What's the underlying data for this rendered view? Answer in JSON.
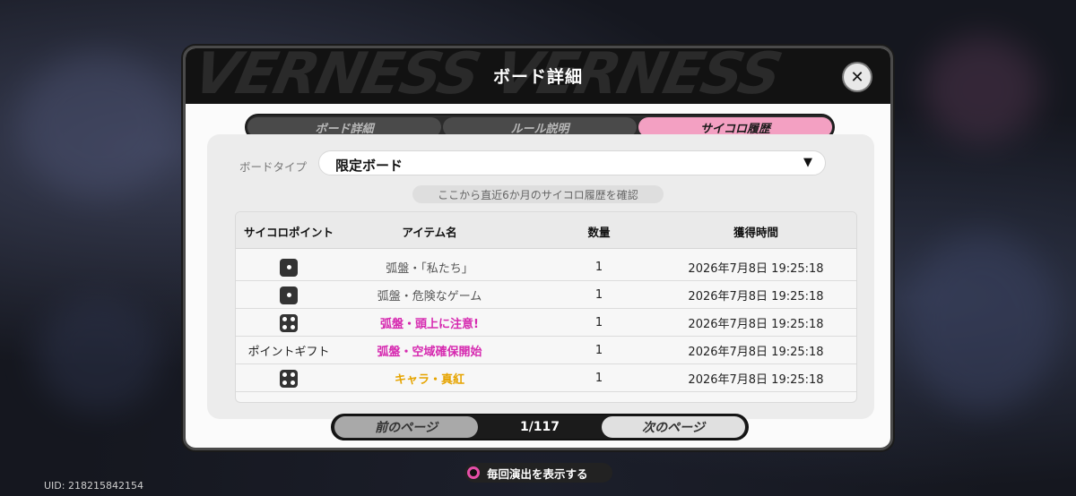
{
  "dialog": {
    "title": "ボード詳細",
    "close_icon": "close-icon",
    "header_deco": "VERNESS VERNESS"
  },
  "tabs": [
    {
      "label": "ボード詳細",
      "active": false
    },
    {
      "label": "ルール説明",
      "active": false
    },
    {
      "label": "サイコロ履歴",
      "active": true
    }
  ],
  "filter": {
    "label": "ボードタイプ",
    "selected": "限定ボード",
    "arrow_icon": "dropdown-arrow-icon"
  },
  "hint": "ここから直近6か月のサイコロ履歴を確認",
  "table": {
    "headers": [
      "サイコロポイント",
      "アイテム名",
      "数量",
      "獲得時間"
    ],
    "rows": [
      {
        "point": "dice-1-icon",
        "point_text": "",
        "item": "弧盤・「私たち」",
        "item_color": "normal",
        "qty": "1",
        "time": "2026年7月8日 19:25:18"
      },
      {
        "point": "dice-1-icon",
        "point_text": "",
        "item": "弧盤・危険なゲーム",
        "item_color": "normal",
        "qty": "1",
        "time": "2026年7月8日 19:25:18"
      },
      {
        "point": "dice-4-icon",
        "point_text": "",
        "item": "弧盤・頭上に注意!",
        "item_color": "pink",
        "qty": "1",
        "time": "2026年7月8日 19:25:18"
      },
      {
        "point": "",
        "point_text": "ポイントギフト",
        "item": "弧盤・空域確保開始",
        "item_color": "pink",
        "qty": "1",
        "time": "2026年7月8日 19:25:18"
      },
      {
        "point": "dice-4-icon",
        "point_text": "",
        "item": "キャラ・真紅",
        "item_color": "gold",
        "qty": "1",
        "time": "2026年7月8日 19:25:18"
      }
    ]
  },
  "pager": {
    "prev_label": "前のページ",
    "indicator": "1/117",
    "next_label": "次のページ"
  },
  "footer": {
    "toggle_label": "毎回演出を表示する"
  },
  "uid": "UID: 218215842154",
  "colors": {
    "accent_pink": "#f3a0c2",
    "item_pink": "#d62ab0",
    "item_gold": "#e6a400",
    "header_bg": "#121212"
  }
}
